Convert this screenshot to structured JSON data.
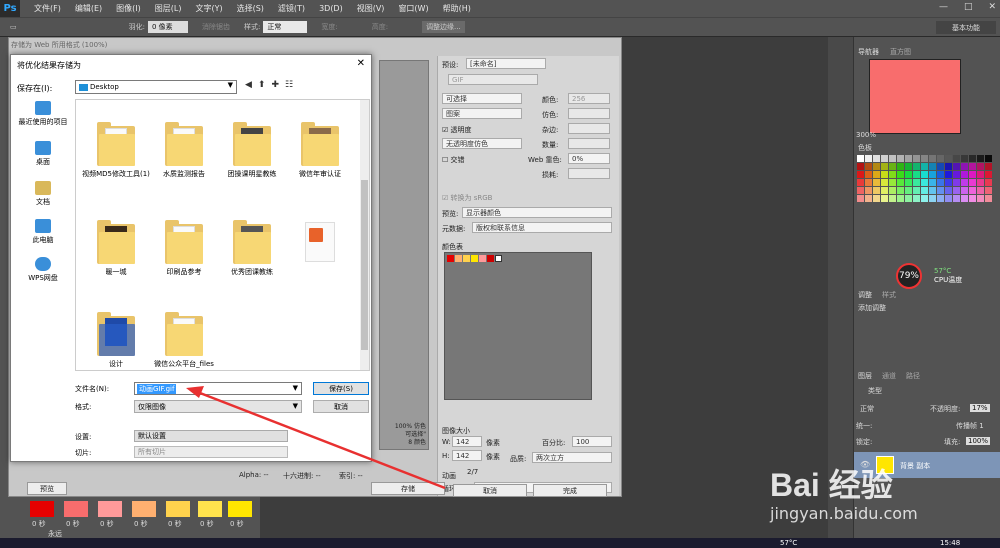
{
  "menubar": {
    "logo": "Ps",
    "items": [
      "文件(F)",
      "编辑(E)",
      "图像(I)",
      "图层(L)",
      "文字(Y)",
      "选择(S)",
      "滤镜(T)",
      "3D(D)",
      "视图(V)",
      "窗口(W)",
      "帮助(H)"
    ]
  },
  "options": {
    "feather_label": "羽化:",
    "feather_value": "0 像素",
    "antialias": "消除锯齿",
    "style_label": "样式:",
    "style_value": "正常",
    "width_label": "宽度:",
    "height_label": "高度:",
    "refine": "调整边缘...",
    "workspace": "基本功能"
  },
  "sfw": {
    "title": "存储为 Web 所用格式 (100%)",
    "preset_label": "预设:",
    "preset_value": "[未命名]",
    "format_value": "GIF",
    "reduction": "可选择",
    "colors_label": "颜色:",
    "colors_value": "256",
    "dither_algo": "图案",
    "dither_label": "仿色:",
    "transparency": "透明度",
    "matte_label": "杂边:",
    "trans_dither": "无透明度仿色",
    "amount_label": "数量:",
    "interlaced": "交错",
    "web_snap_label": "Web 靠色:",
    "web_snap_value": "0%",
    "lossy_label": "损耗:",
    "convert_srgb": "转换为 sRGB",
    "preview_label": "预览:",
    "preview_value": "显示器颜色",
    "metadata_label": "元数据:",
    "metadata_value": "版权和联系信息",
    "color_table_label": "颜色表",
    "image_size_label": "图像大小",
    "w_label": "W:",
    "w_value": "142",
    "h_label": "H:",
    "h_value": "142",
    "px_unit": "像素",
    "percent_label": "百分比:",
    "percent_value": "100",
    "quality_label": "品质:",
    "quality_value": "两次立方",
    "animation_label": "动画",
    "loop_label": "循环选项:",
    "loop_value": "永远",
    "frame_counter": "2/7",
    "preview_info": [
      "100%",
      "仿色",
      "可选择\"",
      "颜色"
    ],
    "preview_info_nums": [
      "8"
    ],
    "alpha_label": "Alpha: --",
    "hex_label": "十六进制: --",
    "index_label": "索引: --",
    "preview_btn": "预览",
    "save_btn": "存储",
    "cancel_btn": "取消",
    "done_btn": "完成"
  },
  "dialog": {
    "title": "将优化结果存储为",
    "save_in_label": "保存在(I):",
    "save_in_value": "Desktop",
    "places": [
      "最近使用的项目",
      "桌面",
      "文档",
      "此电脑",
      "WPS网盘"
    ],
    "files": [
      {
        "name": "视频MD5修改工具(1)",
        "kind": "folder"
      },
      {
        "name": "水质监测报告",
        "kind": "folder"
      },
      {
        "name": "团操课明星教练",
        "kind": "folder"
      },
      {
        "name": "微信年审认证",
        "kind": "folder"
      },
      {
        "name": "暖一城",
        "kind": "folder"
      },
      {
        "name": "印刷品参考",
        "kind": "folder"
      },
      {
        "name": "优秀团课教练",
        "kind": "folder"
      },
      {
        "name": "",
        "kind": "shortcut"
      },
      {
        "name": "设计",
        "kind": "shortcut"
      },
      {
        "name": "微信公众平台_files",
        "kind": "folder"
      }
    ],
    "filename_label": "文件名(N):",
    "filename_value": "动画GIF.gif",
    "format_label": "格式:",
    "format_value": "仅限图像",
    "save_btn": "保存(S)",
    "cancel_btn": "取消",
    "settings_label": "设置:",
    "settings_value": "默认设置",
    "slices_label": "切片:",
    "slices_value": "所有切片"
  },
  "rpanel": {
    "tab_navigator": "导航器",
    "tab_histogram": "直方图",
    "zoom": "300%",
    "tab_swatches": "色板",
    "cpu_percent": "79%",
    "cpu_temp": "57°C",
    "cpu_label": "CPU温度",
    "tab_adjust": "调整",
    "tab_styles": "样式",
    "add_adjust": "添加调整",
    "tab_layers": "图层",
    "tab_channels": "通道",
    "tab_paths": "路径",
    "kind": "类型",
    "blend": "正常",
    "opacity_label": "不透明度:",
    "opacity_value": "17%",
    "unify_label": "统一:",
    "propagate": "传播帧 1",
    "lock_label": "锁定:",
    "fill_label": "填充:",
    "fill_value": "100%",
    "layer_name": "背景 副本"
  },
  "timeline": {
    "frame_time": "0 秒",
    "loop": "永远"
  },
  "taskbar": {
    "temp": "57°C",
    "clock": "15:48"
  },
  "watermark": {
    "main": "Bai  经验",
    "sub": "jingyan.baidu.com"
  },
  "colors": {
    "ps_bg": "#535353",
    "accent": "#0078d7",
    "frame_colors": [
      "#e60000",
      "#f86d6d",
      "#ff9a9a",
      "#ffb070",
      "#ffd24d",
      "#ffe34d",
      "#ffe600"
    ]
  }
}
